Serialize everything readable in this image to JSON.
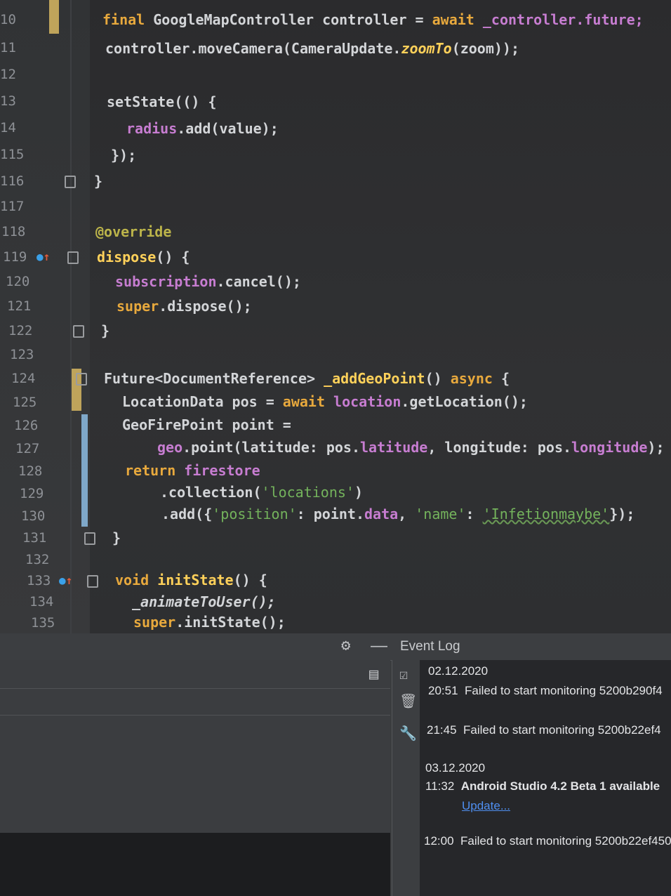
{
  "editor": {
    "line_numbers": [
      "10",
      "11",
      "12",
      "13",
      "14",
      "115",
      "116",
      "117",
      "118",
      "119",
      "120",
      "121",
      "122",
      "123",
      "124",
      "125",
      "126",
      "127",
      "128",
      "129",
      "130",
      "131",
      "132",
      "133",
      "134",
      "135"
    ],
    "lines": {
      "l10": {
        "kw": "final",
        "text": " GoogleMapController controller = ",
        "kw2": "await",
        "rest": " _controller.future;"
      },
      "l11": {
        "a": "controller.moveCamera(CameraUpdate.",
        "b": "zoomTo",
        "c": "(zoom));"
      },
      "l13": "setState(() {",
      "l14": {
        "a": "radius",
        "b": ".add(value);"
      },
      "l115": "});",
      "l116": "}",
      "l118": "@override",
      "l119": {
        "a": "dispose",
        "b": "() {"
      },
      "l120": {
        "a": "subscription",
        "b": ".cancel();"
      },
      "l121": {
        "a": "super",
        "b": ".dispose();"
      },
      "l122": "}",
      "l124": {
        "a": "Future<DocumentReference> ",
        "b": "_addGeoPoint",
        "c": "() ",
        "d": "async",
        "e": " {"
      },
      "l125": {
        "a": "LocationData pos = ",
        "b": "await ",
        "c": "location",
        ".d": "",
        "d": ".getLocation();"
      },
      "l126": "GeoFirePoint point =",
      "l127": {
        "a": "geo",
        ".": "",
        "b": ".point(latitude: pos.",
        "c": "latitude",
        ", ": "",
        "d": ", longitude: pos.",
        "e": "longitude",
        "f": ");"
      },
      "l128": {
        "a": "return ",
        "b": "firestore"
      },
      "l129": {
        "a": ".collection(",
        "b": "'locations'",
        "c": ")"
      },
      "l130": {
        "a": ".add({",
        "b": "'position'",
        "c": ": point.",
        "d": "data",
        ", ": "",
        "e": ", ",
        "f": "'name'",
        "g": ": ",
        "h": "'Infetionmaybe'",
        "i": "});"
      },
      "l131": "}",
      "l133": {
        "a": "void ",
        "b": "initState",
        "c": "() {"
      },
      "l134": "_animateToUser();",
      "l135": {
        "a": "super",
        "b": ".initState();"
      }
    }
  },
  "event_log": {
    "title": "Event Log",
    "entries": [
      {
        "date": "02.12.2020"
      },
      {
        "time": "20:51",
        "message": "Failed to start monitoring 5200b290f4"
      },
      {
        "time": "21:45",
        "message": "Failed to start monitoring 5200b22ef4"
      },
      {
        "date": "03.12.2020"
      },
      {
        "time": "11:32",
        "message": "Android Studio 4.2 Beta 1 available",
        "link": "Update..."
      },
      {
        "time": "12:00",
        "message": "Failed to start monitoring 5200b22ef450"
      }
    ]
  },
  "icons": [
    "gear-icon",
    "minimize-icon",
    "filter-icon",
    "mark-read-icon",
    "trash-icon",
    "wrench-icon",
    "fold-icon",
    "override-icon"
  ]
}
